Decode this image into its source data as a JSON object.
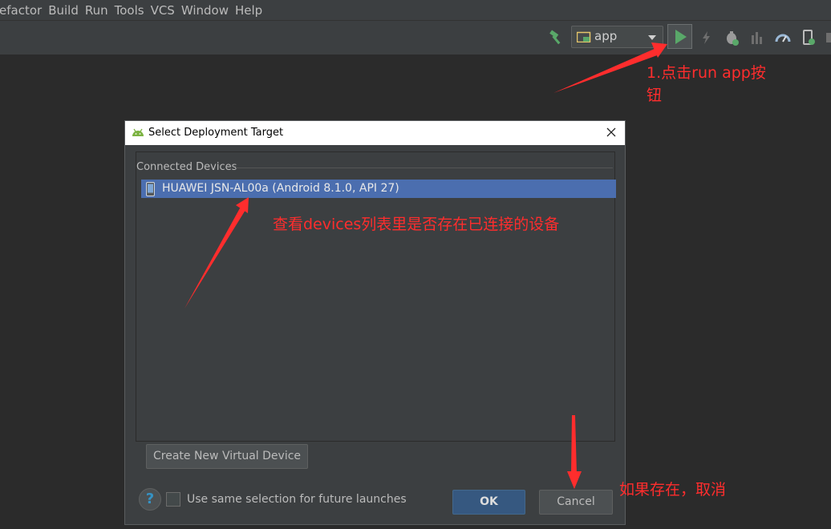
{
  "menubar": {
    "items": [
      {
        "label": "efactor"
      },
      {
        "label": "Build"
      },
      {
        "label": "Run"
      },
      {
        "label": "Tools"
      },
      {
        "label": "VCS"
      },
      {
        "label": "Window"
      },
      {
        "label": "Help"
      }
    ]
  },
  "toolbar": {
    "run_config_label": "app"
  },
  "dialog": {
    "title": "Select Deployment Target",
    "section_label": "Connected Devices",
    "device_label": "HUAWEI JSN-AL00a (Android 8.1.0, API 27)",
    "create_button": "Create New Virtual Device",
    "checkbox_label": "Use same selection for future launches",
    "help_label": "?",
    "ok_button": "OK",
    "cancel_button": "Cancel"
  },
  "annotations": {
    "step1_line1": "1.点击run app按",
    "step1_line2": "钮",
    "check_devices": "查看devices列表里是否存在已连接的设备",
    "if_exists": "如果存在，取消"
  },
  "colors": {
    "annotation": "#ff2d2d",
    "selection": "#4b6eaf",
    "run_green": "#59a869",
    "ok_button": "#365880"
  }
}
